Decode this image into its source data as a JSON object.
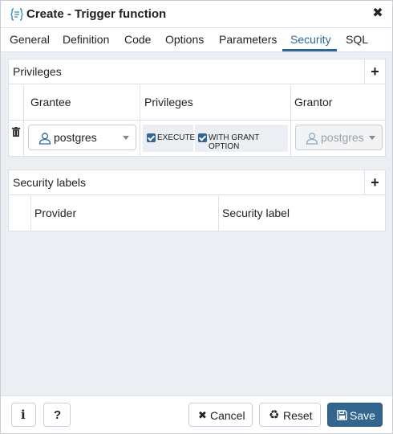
{
  "window": {
    "title": "Create - Trigger function",
    "close_icon": "close-icon"
  },
  "tabs": [
    {
      "label": "General"
    },
    {
      "label": "Definition"
    },
    {
      "label": "Code"
    },
    {
      "label": "Options"
    },
    {
      "label": "Parameters"
    },
    {
      "label": "Security",
      "active": true
    },
    {
      "label": "SQL"
    }
  ],
  "privileges_panel": {
    "title": "Privileges",
    "add_icon": "+",
    "columns": [
      "Grantee",
      "Privileges",
      "Grantor"
    ],
    "row": {
      "grantee": "postgres",
      "privileges": [
        "EXECUTE",
        "WITH GRANT OPTION"
      ],
      "grantor": "postgres"
    }
  },
  "security_labels_panel": {
    "title": "Security labels",
    "add_icon": "+",
    "columns": [
      "Provider",
      "Security label"
    ]
  },
  "footer": {
    "info_label": "i",
    "help_label": "?",
    "cancel_label": "Cancel",
    "reset_label": "Reset",
    "save_label": "Save"
  },
  "colors": {
    "accent": "#326690",
    "background": "#ebeef3",
    "border": "#dde0e6"
  }
}
